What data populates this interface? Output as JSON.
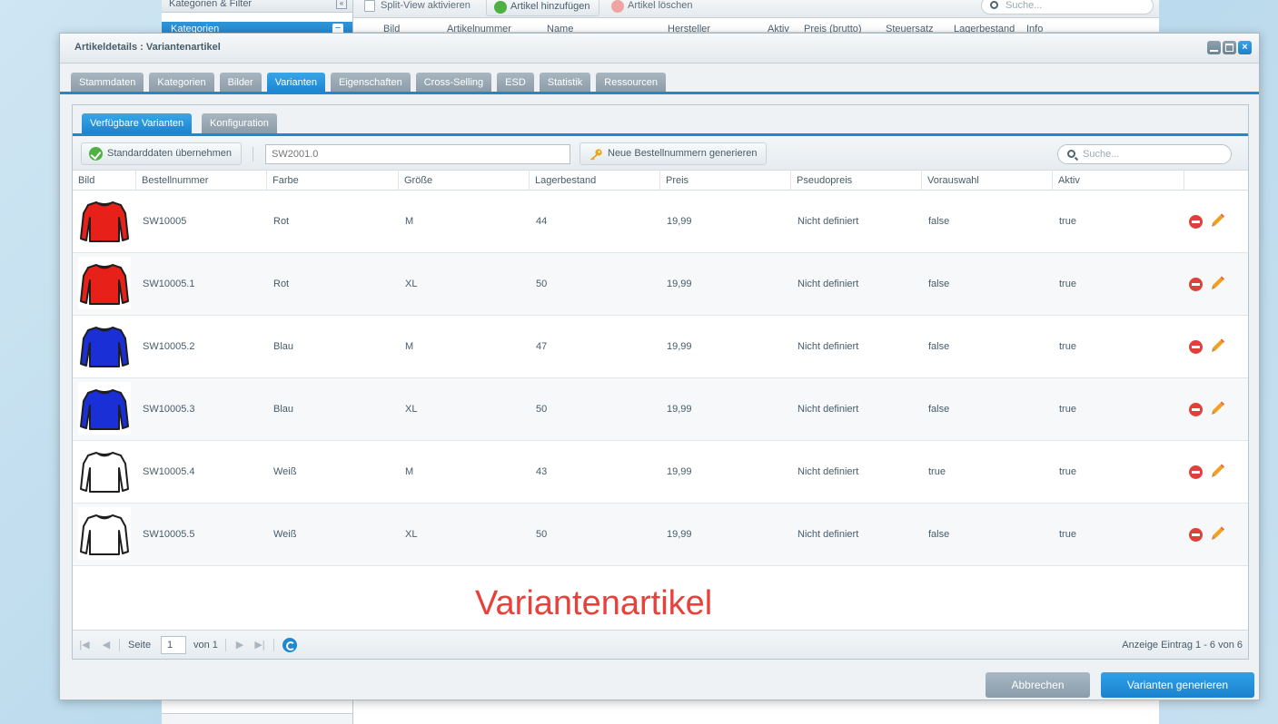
{
  "background": {
    "left_panel": {
      "header": "Kategorien & Filter",
      "category_title": "Kategorien"
    },
    "toolbar": {
      "split_view": "Split-View aktivieren",
      "add_article": "Artikel hinzufügen",
      "delete_article": "Artikel löschen",
      "search_placeholder": "Suche..."
    },
    "grid_headers": [
      "Bild",
      "Artikelnummer",
      "Name",
      "Hersteller",
      "Aktiv",
      "Preis (brutto)",
      "Steuersatz",
      "Lagerbestand",
      "Info"
    ]
  },
  "modal": {
    "title": "Artikeldetails : Variantenartikel",
    "tabs": [
      {
        "label": "Stammdaten",
        "active": false
      },
      {
        "label": "Kategorien",
        "active": false
      },
      {
        "label": "Bilder",
        "active": false
      },
      {
        "label": "Varianten",
        "active": true
      },
      {
        "label": "Eigenschaften",
        "active": false
      },
      {
        "label": "Cross-Selling",
        "active": false
      },
      {
        "label": "ESD",
        "active": false
      },
      {
        "label": "Statistik",
        "active": false
      },
      {
        "label": "Ressourcen",
        "active": false
      }
    ],
    "sub_tabs": [
      {
        "label": "Verfügbare Varianten",
        "active": true
      },
      {
        "label": "Konfiguration",
        "active": false
      }
    ],
    "toolbar": {
      "apply_defaults": "Standarddaten übernehmen",
      "order_number_placeholder": "SW2001.0",
      "generate_numbers": "Neue Bestellnummern generieren",
      "search_placeholder": "Suche..."
    },
    "grid": {
      "columns": [
        "Bild",
        "Bestellnummer",
        "Farbe",
        "Größe",
        "Lagerbestand",
        "Preis",
        "Pseudopreis",
        "Vorauswahl",
        "Aktiv"
      ],
      "rows": [
        {
          "color_hex": "#e8201a",
          "order_no": "SW10005",
          "color": "Rot",
          "size": "M",
          "stock": "44",
          "price": "19,99",
          "pseudo_price": "Nicht definiert",
          "preselect": "false",
          "active": "true"
        },
        {
          "color_hex": "#e8201a",
          "order_no": "SW10005.1",
          "color": "Rot",
          "size": "XL",
          "stock": "50",
          "price": "19,99",
          "pseudo_price": "Nicht definiert",
          "preselect": "false",
          "active": "true"
        },
        {
          "color_hex": "#1a2fd6",
          "order_no": "SW10005.2",
          "color": "Blau",
          "size": "M",
          "stock": "47",
          "price": "19,99",
          "pseudo_price": "Nicht definiert",
          "preselect": "false",
          "active": "true"
        },
        {
          "color_hex": "#1a2fd6",
          "order_no": "SW10005.3",
          "color": "Blau",
          "size": "XL",
          "stock": "50",
          "price": "19,99",
          "pseudo_price": "Nicht definiert",
          "preselect": "false",
          "active": "true"
        },
        {
          "color_hex": "#ffffff",
          "order_no": "SW10005.4",
          "color": "Weiß",
          "size": "M",
          "stock": "43",
          "price": "19,99",
          "pseudo_price": "Nicht definiert",
          "preselect": "true",
          "active": "true"
        },
        {
          "color_hex": "#ffffff",
          "order_no": "SW10005.5",
          "color": "Weiß",
          "size": "XL",
          "stock": "50",
          "price": "19,99",
          "pseudo_price": "Nicht definiert",
          "preselect": "false",
          "active": "true"
        }
      ]
    },
    "overlay_text": "Variantenartikel",
    "pager": {
      "page_label": "Seite",
      "page_value": "1",
      "of_label": "von 1",
      "display_info": "Anzeige Eintrag 1 - 6 von 6"
    },
    "buttons": {
      "cancel": "Abbrechen",
      "generate": "Varianten generieren"
    }
  },
  "colors": {
    "accent": "#1f88d2",
    "delete": "#e0403a",
    "overlay_text": "#e8403a"
  }
}
